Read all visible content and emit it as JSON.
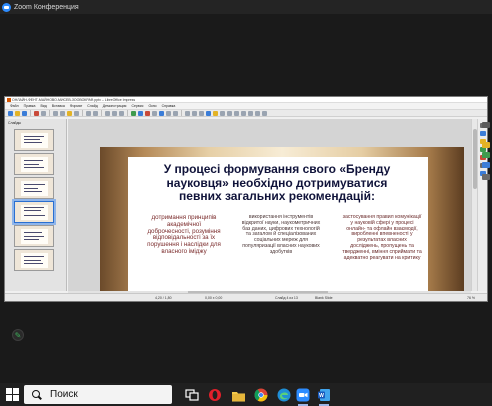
{
  "zoom": {
    "title": "Zoom Конференция"
  },
  "libreoffice": {
    "window_title": "ОНЛАЙН-ФЕНТ-МАЙНОВО-МИСЕВ-ЗООВОКРАФ.pptx – LibreOffice Impress",
    "menu": [
      "Файл",
      "Правка",
      "Вид",
      "Вставка",
      "Формат",
      "Слайд",
      "Демонстрация",
      "Сервис",
      "Окно",
      "Справка"
    ],
    "slides_panel_title": "Слайды",
    "slide": {
      "title": "У процесі формування свого «Бренду науковця» необхідно дотримуватися певних загальних рекомендацій:",
      "col1": "дотримання принципів академічної доброчесності, розуміння відповідальності за їх порушення і наслідки для власного іміджу",
      "col2": "використання інструментів відкритої науки, наукометричних баз даних, цифрових технологій та загалом й спеціалізованих соціальних мереж для популяризації власних наукових здобутків",
      "col3": "застосування правил комунікації у науковій сфері у процесі онлайн- та офлайн взаємодії, виробленні впевненості у результатах власних досліджень, пропущень та твердженні, вміння сприймати та адекватно реагувати на критику"
    },
    "status": {
      "position": "4,20 / 1,80",
      "size": "0,00 x 0,00",
      "slide_counter": "Слайд 4 из 13",
      "layout": "Blank Slide",
      "zoom_level": "76 %"
    }
  },
  "taskbar": {
    "search_text": "Поиск",
    "apps": [
      "file-explorer",
      "opera",
      "chrome",
      "edge",
      "zoom",
      "word"
    ]
  },
  "colors": {
    "zoom_blue": "#2d8cff",
    "title_navy": "#10133a",
    "col_red": "#7a2a2a"
  }
}
